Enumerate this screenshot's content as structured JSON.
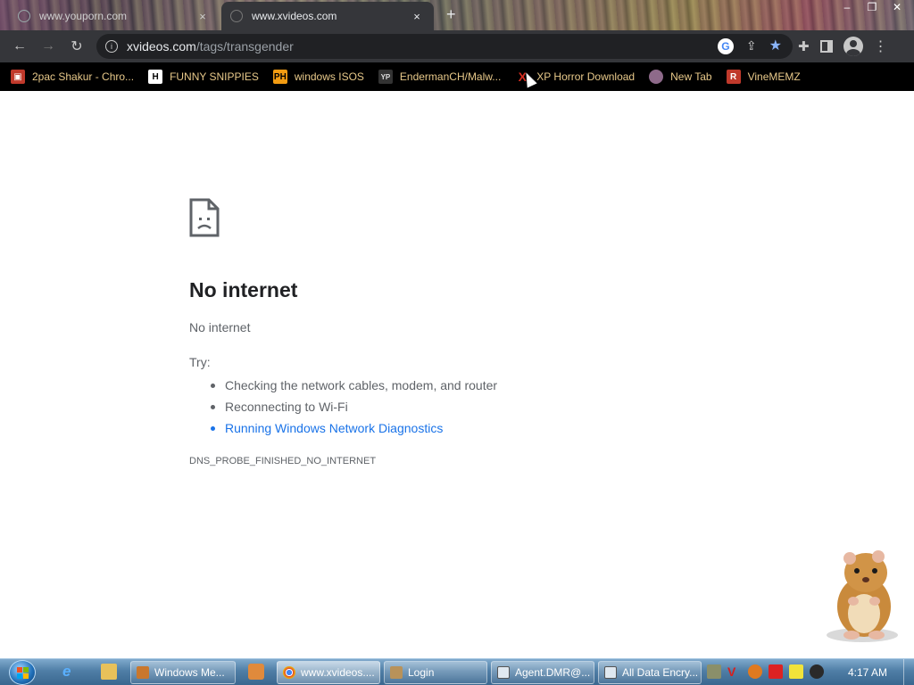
{
  "browser": {
    "tabs": [
      {
        "title": "www.youporn.com",
        "close": "×"
      },
      {
        "title": "www.xvideos.com",
        "close": "×"
      }
    ],
    "new_tab": "+",
    "window_controls": {
      "minimize": "–",
      "restore": "❐",
      "close": "✕"
    },
    "omnibox": {
      "host": "xvideos.com",
      "path": "/tags/transgender",
      "google_badge": "G"
    },
    "bookmarks": [
      {
        "label": "2pac Shakur - Chro...",
        "icon": "2pac-favicon",
        "icon_text": "▣"
      },
      {
        "label": "FUNNY SNIPPIES",
        "icon": "h-favicon",
        "icon_text": "H"
      },
      {
        "label": "windows ISOS",
        "icon": "ph-favicon",
        "icon_text": "PH"
      },
      {
        "label": "EndermanCH/Malw...",
        "icon": "github-favicon",
        "icon_text": "YP"
      },
      {
        "label": "XP Horror Download",
        "icon": "x-favicon",
        "icon_text": "X"
      },
      {
        "label": "New Tab",
        "icon": "newtab-favicon",
        "icon_text": ""
      },
      {
        "label": "VineMEMZ",
        "icon": "r-favicon",
        "icon_text": "R"
      }
    ]
  },
  "error_page": {
    "title": "No internet",
    "subtitle": "No internet",
    "try_label": "Try:",
    "suggestions": [
      "Checking the network cables, modem, and router",
      "Reconnecting to Wi-Fi",
      "Running Windows Network Diagnostics"
    ],
    "error_code": "DNS_PROBE_FINISHED_NO_INTERNET"
  },
  "taskbar": {
    "tasks": [
      {
        "label": "Windows Me..."
      },
      {
        "label": "www.xvideos...."
      },
      {
        "label": "Login"
      },
      {
        "label": "Agent.DMR@..."
      },
      {
        "label": "All Data Encry..."
      }
    ],
    "clock": "4:17 AM"
  },
  "colors": {
    "tab_active": "#35363a",
    "toolbar": "#35363a",
    "bookmarks_bar": "#000000",
    "bookmark_text": "#e8c98a",
    "link": "#1a73e8",
    "taskbar": "#4f7ea6"
  }
}
